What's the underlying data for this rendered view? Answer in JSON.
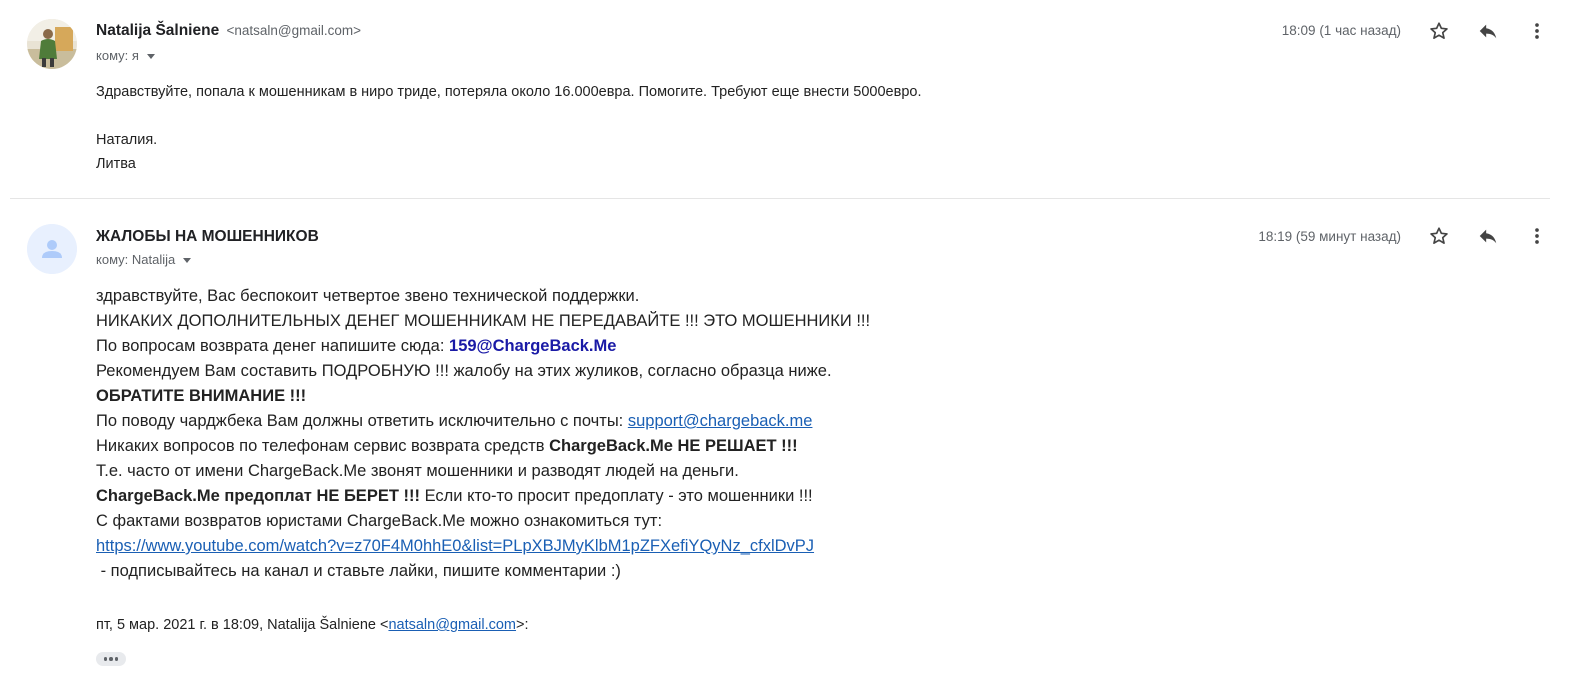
{
  "messages": [
    {
      "sender_name": "Natalija Šalniene",
      "sender_email": "<natsaln@gmail.com>",
      "recipient": "кому: я",
      "time": "18:09 (1 час назад)",
      "body": [
        "Здравствуйте, попала к мошенникам в ниро триде, потеряла около 16.000евра. Помогите. Требуют еще внести 5000евро.",
        "Наталия.",
        "Литва"
      ]
    },
    {
      "sender_name": "ЖАЛОБЫ НА МОШЕННИКОВ",
      "recipient": "кому: Natalija",
      "time": "18:19 (59 минут назад)",
      "body": {
        "l1": "здравствуйте, Вас беспокоит четвертое звено технической поддержки.",
        "l2": "НИКАКИХ ДОПОЛНИТЕЛЬНЫХ ДЕНЕГ МОШЕННИКАМ НЕ ПЕРЕДАВАЙТЕ !!! ЭТО МОШЕННИКИ !!!",
        "l3_text": "По вопросам возврата денег напишите сюда: ",
        "l3_email": "159@ChargeBack.Me",
        "l4": "Рекомендуем Вам составить ПОДРОБНУЮ !!! жалобу на этих жуликов, согласно образца ниже.",
        "l5": "ОБРАТИТЕ ВНИМАНИЕ !!!",
        "l6_text": "По поводу чарджбека Вам должны ответить исключительно с почты: ",
        "l6_link": "support@chargeback.me",
        "l7_text": "Никаких вопросов по телефонам сервис возврата средств ",
        "l7_bold": "ChargeBack.Me НЕ РЕШАЕТ !!!",
        "l8": "Т.е. часто от имени ChargeBack.Me звонят мошенники и разводят людей на деньги.",
        "l9_bold": "ChargeBack.Me предоплат НЕ БЕРЕТ !!!",
        "l9_text": " Если кто-то просит предоплату - это мошенники !!!",
        "l10": "С фактами возвратов юристами ChargeBack.Me можно ознакомиться тут:",
        "l11_link": "https://www.youtube.com/watch?v=z70F4M0hhE0&list=PLpXBJMyKlbM1pZFXefiYQyNz_cfxlDvPJ",
        "l12": " - подписывайтесь на канал и ставьте лайки, пишите комментарии :)"
      },
      "quote": {
        "prefix": "пт, 5 мар. 2021 г. в 18:09, Natalija Šalniene <",
        "email": "natsaln@gmail.com",
        "suffix": ">:"
      }
    }
  ],
  "icons": {
    "star": "star-icon",
    "reply": "reply-icon",
    "more": "more-vert-icon",
    "caret": "caret-down-icon",
    "avatar_default": "person-icon",
    "ellipsis": "more-horiz-icon"
  },
  "colors": {
    "link": "#1a5fb4",
    "email_highlight": "#1a1aa6",
    "avatar_bg": "#e8f0fe",
    "avatar_icon": "#aecbfa"
  }
}
